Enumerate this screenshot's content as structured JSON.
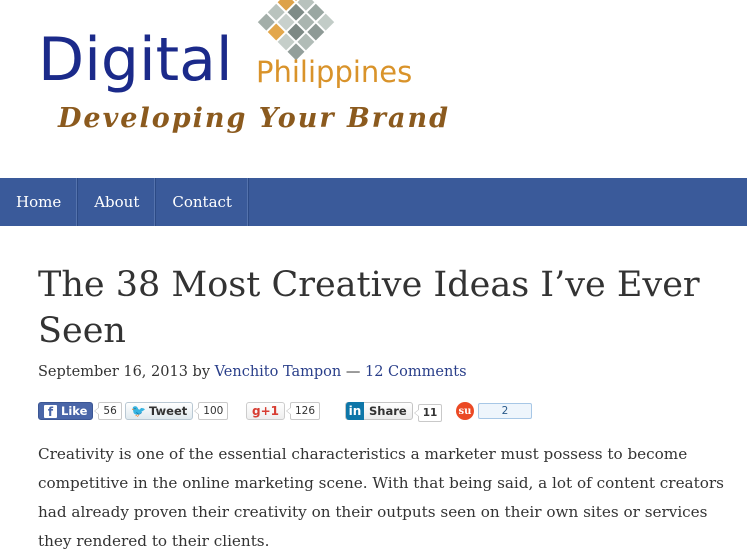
{
  "logo": {
    "brand_main": "Digital",
    "brand_sub": "Philippines",
    "tagline": "Developing Your Brand"
  },
  "nav": {
    "items": [
      {
        "label": "Home"
      },
      {
        "label": "About"
      },
      {
        "label": "Contact"
      }
    ]
  },
  "article": {
    "title": "The 38 Most Creative Ideas I’ve Ever Seen",
    "date": "September 16, 2013",
    "by": "by",
    "author": "Venchito Tampon",
    "separator": "—",
    "comments": "12 Comments",
    "body": "Creativity is one of the essential characteristics a marketer must possess to become competitive in the online marketing scene. With that being said, a lot of content creators had already proven their creativity on their outputs seen on their own sites or services they rendered to their clients."
  },
  "shares": {
    "facebook": {
      "icon": "f",
      "label": "Like",
      "count": "56"
    },
    "twitter": {
      "label": "Tweet",
      "count": "100"
    },
    "googleplus": {
      "label": "g+1",
      "count": "126"
    },
    "linkedin": {
      "icon": "in",
      "label": "Share",
      "count": "11"
    },
    "stumbleupon": {
      "count": "2"
    }
  },
  "colors": {
    "nav_bg": "#3a5a9a",
    "brand_blue": "#1b2a8a",
    "brand_orange": "#d9932a",
    "tagline_brown": "#8b5a1e",
    "link": "#2a3f8a"
  }
}
